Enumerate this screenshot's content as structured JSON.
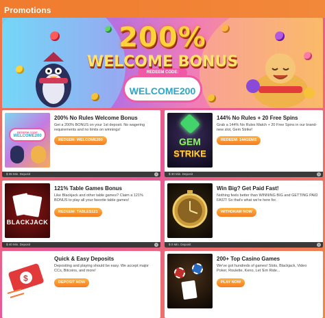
{
  "header": {
    "title": "Promotions"
  },
  "hero": {
    "headline": "200%",
    "subhead": "WELCOME BONUS",
    "code_label": "REDEEM CODE:",
    "code_value": "WELCOME200"
  },
  "cards": [
    {
      "title": "200% No Rules Welcome Bonus",
      "desc": "Get a 200% BONUS on your 1st deposit. No wagering requirements and no limits on winnings!",
      "button": "REDEEM: WELCOME200",
      "footer": "$ 35 Min. Deposit",
      "thumb_label_1": "REDEEM CODE",
      "thumb_label_2": "WELCOME200"
    },
    {
      "title": "144% No Rules + 20 Free Spins",
      "desc": "Grab a 144% No Rules Match + 20 Free Spins in our brand-new slot, Gem Strike!",
      "button": "REDEEM: 144GEMS",
      "footer": "$ 30 Min. Deposit",
      "thumb_label_1": "GEM",
      "thumb_label_2": "STRIKE"
    },
    {
      "title": "121% Table Games Bonus",
      "desc": "Like Blackjack and other table games? Claim a 121% BONUS to play all your favorite table games!",
      "button": "REDEEM: TABLES121",
      "footer": "$ 40 Min. Deposit",
      "thumb_label_1": "BLACKJACK",
      "thumb_label_2": ""
    },
    {
      "title": "Win Big? Get Paid Fast!",
      "desc": "Nothing feels better than WINNING BIG and GETTING PAID FAST! So that's what we're here for.",
      "button": "WITHDRAW NOW",
      "footer": "$ 0 Min. Deposit",
      "thumb_label_1": "",
      "thumb_label_2": ""
    },
    {
      "title": "Quick & Easy Deposits",
      "desc": "Depositing and playing should be easy. We accept major CCs, Bitcoins, and more!",
      "button": "DEPOSIT NOW",
      "footer": "",
      "thumb_label_1": "",
      "thumb_label_2": ""
    },
    {
      "title": "200+ Top Casino Games",
      "desc": "We've got hundreds of games! Slots, Blackjack, Video Poker, Roulette, Keno, Let 'Em Ride...",
      "button": "PLAY NOW",
      "footer": "",
      "thumb_label_1": "",
      "thumb_label_2": ""
    }
  ],
  "colors": {
    "accent_orange": "#f57c1f",
    "brand_pink": "#f05aa4",
    "code_blue": "#2aa6c9"
  }
}
